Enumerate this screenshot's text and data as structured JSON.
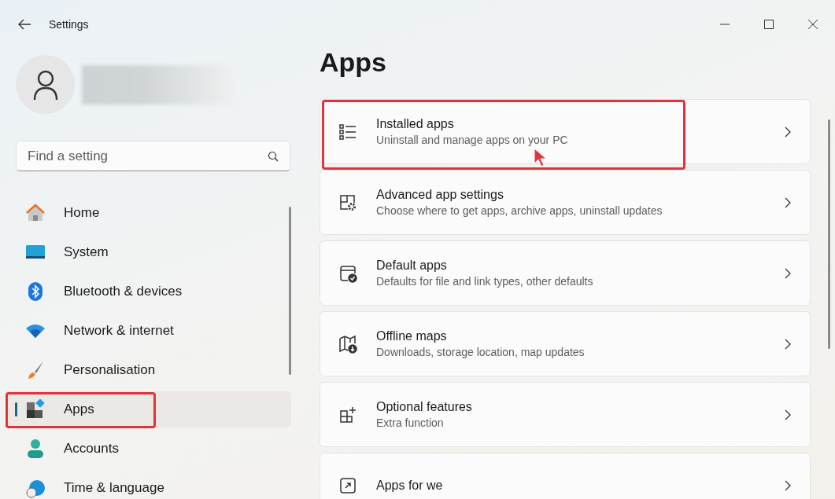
{
  "window": {
    "title": "Settings"
  },
  "search": {
    "placeholder": "Find a setting"
  },
  "sidebar": {
    "items": [
      {
        "label": "Home",
        "selected": false,
        "highlighted": false
      },
      {
        "label": "System",
        "selected": false,
        "highlighted": false
      },
      {
        "label": "Bluetooth & devices",
        "selected": false,
        "highlighted": false
      },
      {
        "label": "Network & internet",
        "selected": false,
        "highlighted": false
      },
      {
        "label": "Personalisation",
        "selected": false,
        "highlighted": false
      },
      {
        "label": "Apps",
        "selected": true,
        "highlighted": true
      },
      {
        "label": "Accounts",
        "selected": false,
        "highlighted": false
      },
      {
        "label": "Time & language",
        "selected": false,
        "highlighted": false
      }
    ]
  },
  "page": {
    "title": "Apps",
    "cards": [
      {
        "title": "Installed apps",
        "subtitle": "Uninstall and manage apps on your PC",
        "highlighted": true
      },
      {
        "title": "Advanced app settings",
        "subtitle": "Choose where to get apps, archive apps, uninstall updates",
        "highlighted": false
      },
      {
        "title": "Default apps",
        "subtitle": "Defaults for file and link types, other defaults",
        "highlighted": false
      },
      {
        "title": "Offline maps",
        "subtitle": "Downloads, storage location, map updates",
        "highlighted": false
      },
      {
        "title": "Optional features",
        "subtitle": "Extra function",
        "highlighted": false
      },
      {
        "title": "Apps for we",
        "highlighted": false
      }
    ]
  }
}
